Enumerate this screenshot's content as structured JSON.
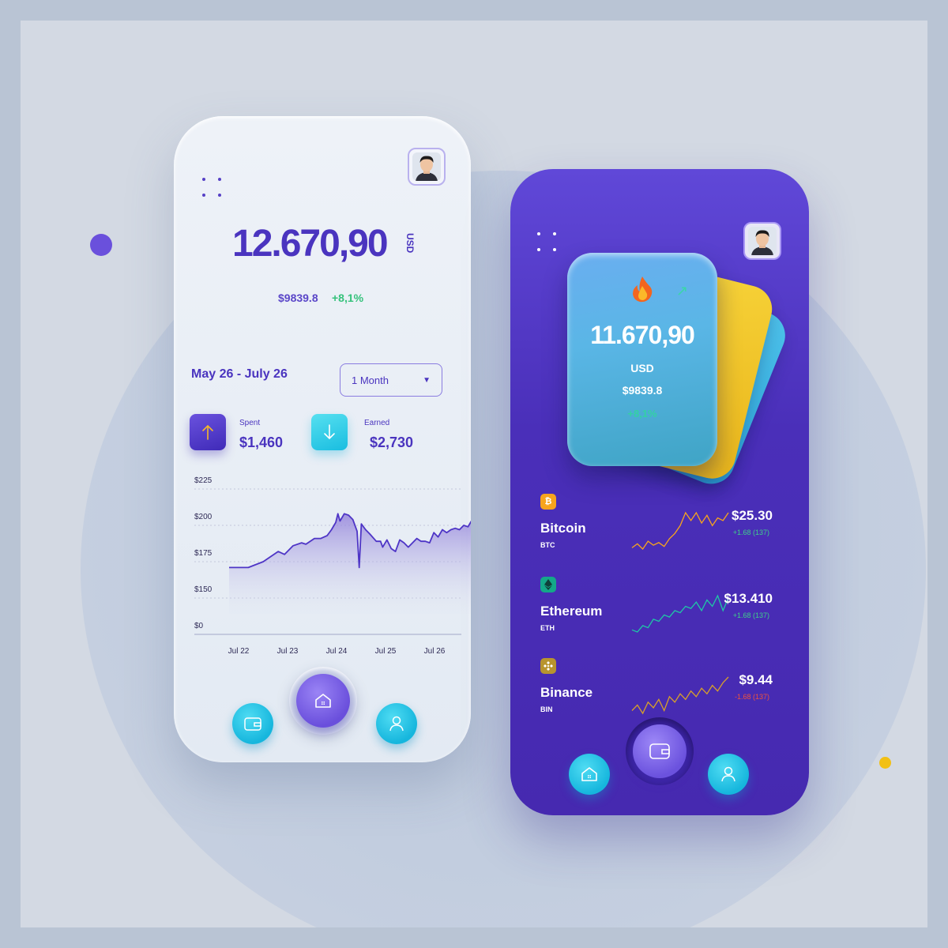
{
  "colors": {
    "accent": "#4a34bf",
    "positive": "#35c27b",
    "negative": "#f0523c",
    "cyan": "#19bde0",
    "dark_bg": "#4a2fb9"
  },
  "left_screen": {
    "menu_icon": "grid-dots-icon",
    "avatar": "user-avatar",
    "balance": {
      "amount": "12.670,90",
      "unit": "USD",
      "sub_value": "$9839.8",
      "change": "+8,1%"
    },
    "date_range": "May 26 - July 26",
    "period_select": {
      "value": "1 Month"
    },
    "spent": {
      "label": "Spent",
      "value": "$1,460",
      "icon": "arrow-up-icon"
    },
    "earned": {
      "label": "Earned",
      "value": "$2,730",
      "icon": "arrow-down-icon"
    },
    "nav": {
      "left": "wallet-icon",
      "center": "home-icon",
      "right": "user-icon"
    }
  },
  "chart_data": {
    "type": "area",
    "y_ticks": [
      "$225",
      "$200",
      "$175",
      "$150",
      "$0"
    ],
    "x_ticks": [
      "Jul 22",
      "Jul 23",
      "Jul 24",
      "Jul 25",
      "Jul 26"
    ],
    "ylim": [
      150,
      225
    ],
    "series": [
      {
        "values": [
          [
            0,
            171
          ],
          [
            0.45,
            171
          ],
          [
            0.8,
            175
          ],
          [
            1.0,
            179
          ],
          [
            1.15,
            182
          ],
          [
            1.3,
            180
          ],
          [
            1.5,
            186
          ],
          [
            1.7,
            188
          ],
          [
            1.8,
            187
          ],
          [
            2.0,
            191
          ],
          [
            2.15,
            191
          ],
          [
            2.3,
            193
          ],
          [
            2.4,
            197
          ],
          [
            2.5,
            202
          ],
          [
            2.55,
            208
          ],
          [
            2.6,
            203
          ],
          [
            2.7,
            208
          ],
          [
            2.8,
            207
          ],
          [
            2.9,
            204
          ],
          [
            3.0,
            196
          ],
          [
            3.05,
            171
          ],
          [
            3.1,
            201
          ],
          [
            3.2,
            197
          ],
          [
            3.3,
            194
          ],
          [
            3.45,
            189
          ],
          [
            3.55,
            189
          ],
          [
            3.6,
            185
          ],
          [
            3.7,
            190
          ],
          [
            3.8,
            184
          ],
          [
            3.9,
            182
          ],
          [
            4.0,
            190
          ],
          [
            4.1,
            188
          ],
          [
            4.2,
            185
          ],
          [
            4.3,
            188
          ],
          [
            4.4,
            191
          ],
          [
            4.5,
            189
          ],
          [
            4.6,
            189
          ],
          [
            4.7,
            188
          ],
          [
            4.8,
            195
          ],
          [
            4.9,
            192
          ],
          [
            5.0,
            197
          ],
          [
            5.1,
            195
          ],
          [
            5.2,
            197
          ],
          [
            5.3,
            198
          ],
          [
            5.4,
            197
          ],
          [
            5.5,
            200
          ],
          [
            5.6,
            199
          ],
          [
            5.7,
            204
          ],
          [
            5.8,
            209
          ],
          [
            5.9,
            197
          ]
        ]
      }
    ]
  },
  "right_screen": {
    "menu_icon": "grid-dots-icon",
    "avatar": "user-avatar",
    "card": {
      "icon": "fire-icon",
      "trend_icon": "trend-up-icon",
      "amount": "11.670,90",
      "unit": "USD",
      "sub_value": "$9839.8",
      "change": "+8,1%"
    },
    "coins": [
      {
        "name": "Bitcoin",
        "symbol": "BTC",
        "price": "$25.30",
        "change": "+1.68 (137)",
        "icon": "bitcoin-icon",
        "color": "#f7a41d",
        "spark": [
          3,
          6,
          2,
          8,
          5,
          7,
          4,
          10,
          14,
          20,
          30,
          24,
          30,
          22,
          28,
          20,
          26,
          24,
          30
        ]
      },
      {
        "name": "Ethereum",
        "symbol": "ETH",
        "price": "$13.410",
        "change": "+1.68 (137)",
        "icon": "ethereum-icon",
        "color": "#1fc7a6",
        "spark": [
          4,
          2,
          8,
          6,
          14,
          12,
          18,
          16,
          22,
          20,
          26,
          24,
          30,
          22,
          32,
          26,
          36,
          22,
          34
        ]
      },
      {
        "name": "Binance",
        "symbol": "BIN",
        "price": "$9.44",
        "change": "-1.68 (137)",
        "icon": "binance-icon",
        "color": "#d8a02a",
        "spark": [
          6,
          10,
          4,
          12,
          8,
          14,
          6,
          16,
          12,
          18,
          14,
          20,
          16,
          22,
          18,
          24,
          20,
          26,
          30
        ]
      }
    ],
    "nav": {
      "left": "home-icon",
      "center": "wallet-icon",
      "right": "user-icon"
    }
  }
}
